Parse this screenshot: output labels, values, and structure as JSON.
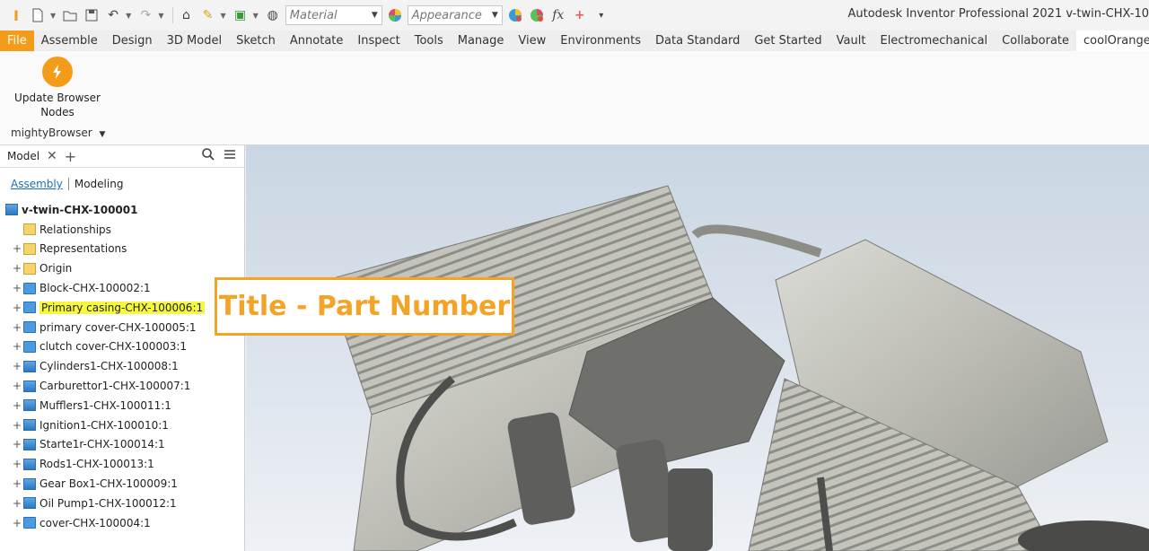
{
  "window": {
    "app_title": "Autodesk Inventor Professional 2021    v-twin-CHX-10"
  },
  "quick_access": {
    "material_placeholder": "Material",
    "appearance_placeholder": "Appearance",
    "fx_label": "fx"
  },
  "ribbon": {
    "tabs": [
      "File",
      "Assemble",
      "Design",
      "3D Model",
      "Sketch",
      "Annotate",
      "Inspect",
      "Tools",
      "Manage",
      "View",
      "Environments",
      "Data Standard",
      "Get Started",
      "Vault",
      "Electromechanical",
      "Collaborate",
      "coolOrange"
    ],
    "active_tab": "coolOrange",
    "update_button_label": "Update Browser\nNodes",
    "panel_name": "mightyBrowser"
  },
  "browser": {
    "tab_label": "Model",
    "views": {
      "assembly": "Assembly",
      "modeling": "Modeling"
    },
    "tree": [
      {
        "label": "v-twin-CHX-100001",
        "icon": "assembly-icon",
        "root": true
      },
      {
        "label": "Relationships",
        "icon": "folder-icon"
      },
      {
        "label": "Representations",
        "icon": "representations-icon",
        "expandable": true
      },
      {
        "label": "Origin",
        "icon": "folder-icon",
        "expandable": true
      },
      {
        "label": "Block-CHX-100002:1",
        "icon": "part-icon",
        "expandable": true
      },
      {
        "label": "Primary casing-CHX-100006:1",
        "icon": "part-icon",
        "expandable": true,
        "highlighted": true
      },
      {
        "label": "primary cover-CHX-100005:1",
        "icon": "part-icon",
        "expandable": true
      },
      {
        "label": "clutch cover-CHX-100003:1",
        "icon": "part-icon",
        "expandable": true
      },
      {
        "label": "Cylinders1-CHX-100008:1",
        "icon": "subassembly-icon",
        "expandable": true
      },
      {
        "label": "Carburettor1-CHX-100007:1",
        "icon": "subassembly-icon",
        "expandable": true
      },
      {
        "label": "Mufflers1-CHX-100011:1",
        "icon": "subassembly-icon",
        "expandable": true
      },
      {
        "label": "Ignition1-CHX-100010:1",
        "icon": "subassembly-icon",
        "expandable": true
      },
      {
        "label": "Starte1r-CHX-100014:1",
        "icon": "subassembly-icon",
        "expandable": true
      },
      {
        "label": "Rods1-CHX-100013:1",
        "icon": "subassembly-icon",
        "expandable": true
      },
      {
        "label": "Gear Box1-CHX-100009:1",
        "icon": "subassembly-icon",
        "expandable": true
      },
      {
        "label": "Oil Pump1-CHX-100012:1",
        "icon": "subassembly-icon",
        "expandable": true
      },
      {
        "label": "cover-CHX-100004:1",
        "icon": "part-icon",
        "expandable": true
      }
    ]
  },
  "viewport": {
    "callout_text": "Title - Part Number"
  },
  "colors": {
    "accent": "#f39c1a",
    "highlight": "#f7f93e",
    "link": "#1f6fb5"
  }
}
